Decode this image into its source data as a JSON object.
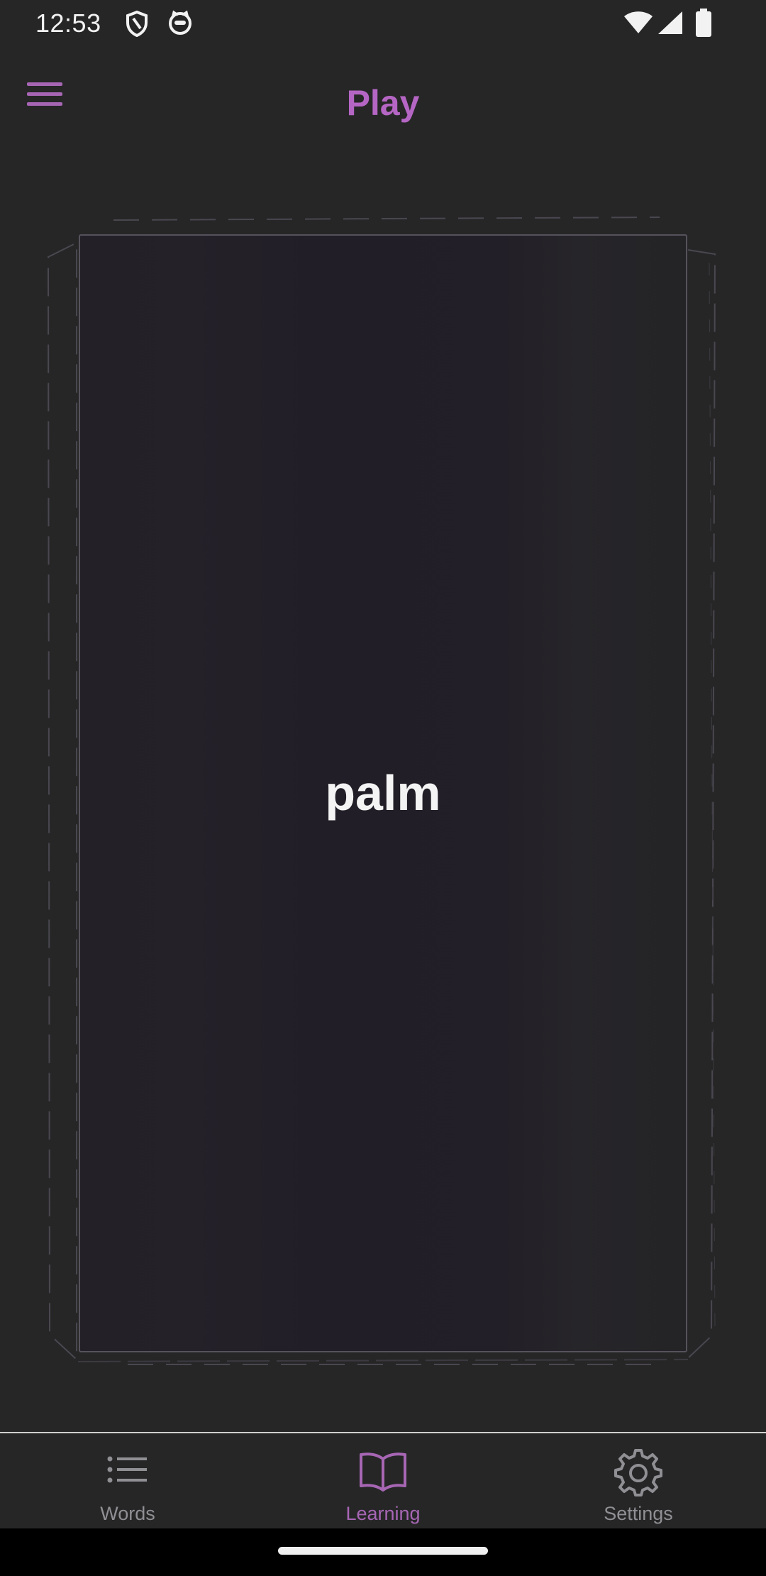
{
  "status_bar": {
    "time": "12:53",
    "left_icons": [
      "shield-icon",
      "cat-icon"
    ],
    "right_icons": [
      "wifi-icon",
      "signal-icon",
      "battery-icon"
    ]
  },
  "app_bar": {
    "title": "Play",
    "menu_icon": "hamburger-menu-icon"
  },
  "card": {
    "word": "palm"
  },
  "bottom_nav": {
    "items": [
      {
        "label": "Words",
        "icon": "list-icon",
        "active": false
      },
      {
        "label": "Learning",
        "icon": "book-icon",
        "active": true
      },
      {
        "label": "Settings",
        "icon": "gear-icon",
        "active": false
      }
    ]
  },
  "colors": {
    "accent": "#b566c4",
    "background": "#262627",
    "inactive": "#8f8f94"
  }
}
